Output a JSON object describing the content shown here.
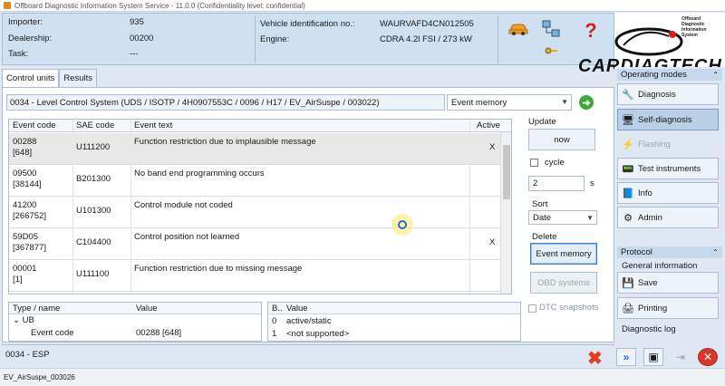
{
  "window": {
    "title": "Offboard Diagnostic Information System Service - 11.0.0 (Confidentiality level: confidential)"
  },
  "info": {
    "importer_label": "Importer:",
    "importer_value": "935",
    "dealership_label": "Dealership:",
    "dealership_value": "00200",
    "task_label": "Task:",
    "task_value": "---",
    "vin_label": "Vehicle identification no.:",
    "vin_value": "WAURVAFD4CN012505",
    "engine_label": "Engine:",
    "engine_value": "CDRA 4.2l FSI / 273 kW"
  },
  "brand": {
    "small_lines": [
      "Offboard",
      "Diagnostic",
      "Information",
      "System"
    ],
    "big": "CARDIAGTECH"
  },
  "tabs": [
    {
      "label": "Control units"
    },
    {
      "label": "Results"
    }
  ],
  "ecu": {
    "title": "0034 - Level Control System  (UDS / ISOTP / 4H0907553C / 0096 / H17 / EV_AirSuspe / 003022)",
    "view_select": "Event memory"
  },
  "grid": {
    "headers": [
      "Event code",
      "SAE code",
      "Event text",
      "Active"
    ],
    "rows": [
      {
        "code": "00288",
        "sub": "[648]",
        "sae": "U111200",
        "text": "Function restriction due to implausible message",
        "active": "X"
      },
      {
        "code": "09500",
        "sub": "[38144]",
        "sae": "B201300",
        "text": "No band end programming occurs",
        "active": ""
      },
      {
        "code": "41200",
        "sub": "[266752]",
        "sae": "U101300",
        "text": "Control module not coded",
        "active": ""
      },
      {
        "code": "59D05",
        "sub": "[367877]",
        "sae": "C104400",
        "text": "Control position not learned",
        "active": "X"
      },
      {
        "code": "00001",
        "sub": "[1]",
        "sae": "U111100",
        "text": "Function restriction due to missing message",
        "active": ""
      }
    ]
  },
  "controls": {
    "update_label": "Update",
    "now_button": "now",
    "cycle_label": "cycle",
    "cycle_value": "2",
    "cycle_unit": "s",
    "sort_label": "Sort",
    "sort_value": "Date",
    "delete_label": "Delete",
    "event_memory_button": "Event memory",
    "obd_button": "OBD systems",
    "dtc_label": "DTC snapshots"
  },
  "tree": {
    "col1": "Type / name",
    "col2": "Value",
    "node": "UB",
    "row_name": "Event code",
    "row_value": "00288 [648]"
  },
  "detail": {
    "col1": "B..",
    "col2": "Value",
    "rows": [
      {
        "b": "0",
        "v": "active/static"
      },
      {
        "b": "1",
        "v": "<not supported>"
      }
    ]
  },
  "status": {
    "left": "0034 - ESP"
  },
  "footer": {
    "text": "EV_AirSuspe_003026"
  },
  "sidebar": {
    "operating_title": "Operating modes",
    "items": [
      {
        "label": "Diagnosis",
        "icon": "stethoscope-icon",
        "state": "normal"
      },
      {
        "label": "Self-diagnosis",
        "icon": "self-diagnosis-icon",
        "state": "active"
      },
      {
        "label": "Flashing",
        "icon": "flash-icon",
        "state": "disabled"
      },
      {
        "label": "Test instruments",
        "icon": "gauge-icon",
        "state": "normal"
      },
      {
        "label": "Info",
        "icon": "book-icon",
        "state": "normal"
      },
      {
        "label": "Admin",
        "icon": "admin-icon",
        "state": "normal"
      }
    ],
    "protocol_title": "Protocol",
    "general_info": "General information",
    "save_label": "Save",
    "printing_label": "Printing",
    "diag_log": "Diagnostic log"
  },
  "colors": {
    "accent": "#3c7fc1",
    "panel": "#cfe0f1",
    "close": "#e0401f",
    "go": "#3ea83a"
  }
}
